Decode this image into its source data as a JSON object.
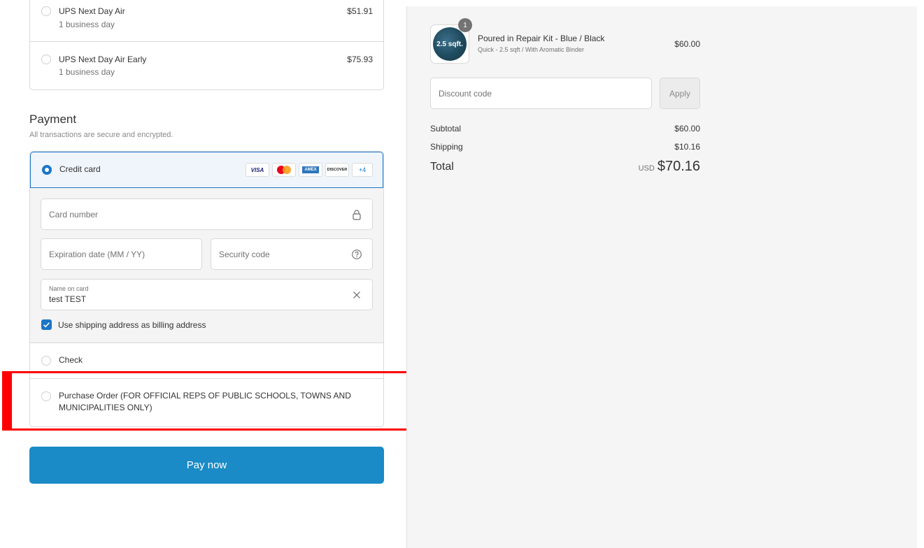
{
  "shipping": {
    "options": [
      {
        "name": "UPS Next Day Air",
        "detail": "1 business day",
        "price": "$51.91"
      },
      {
        "name": "UPS Next Day Air Early",
        "detail": "1 business day",
        "price": "$75.93"
      }
    ]
  },
  "payment": {
    "title": "Payment",
    "subtitle": "All transactions are secure and encrypted.",
    "credit_card": {
      "label": "Credit card",
      "brands": {
        "visa": "VISA",
        "amex": "AMEX",
        "discover": "DISCOVER",
        "more": "+4"
      },
      "card_number_placeholder": "Card number",
      "expiration_placeholder": "Expiration date (MM / YY)",
      "security_placeholder": "Security code",
      "name_label": "Name on card",
      "name_value": "test TEST",
      "billing_checkbox_label": "Use shipping address as billing address",
      "billing_checked": true
    },
    "check_label": "Check",
    "po_label": "Purchase Order (FOR OFFICIAL REPS OF PUBLIC SCHOOLS, TOWNS AND MUNICIPALITIES ONLY)",
    "pay_button": "Pay now"
  },
  "summary": {
    "item": {
      "quantity": "1",
      "thumb_text": "2.5 sqft.",
      "name": "Poured in Repair Kit - Blue / Black",
      "variant": "Quick - 2.5 sqft / With Aromatic Binder",
      "price": "$60.00"
    },
    "discount_placeholder": "Discount code",
    "apply_label": "Apply",
    "subtotal_label": "Subtotal",
    "subtotal_value": "$60.00",
    "shipping_label": "Shipping",
    "shipping_value": "$10.16",
    "total_label": "Total",
    "total_currency": "USD",
    "total_value": "$70.16"
  },
  "colors": {
    "accent": "#1a75c8",
    "pay_button": "#1a8bc6",
    "highlight": "#ff0000"
  }
}
